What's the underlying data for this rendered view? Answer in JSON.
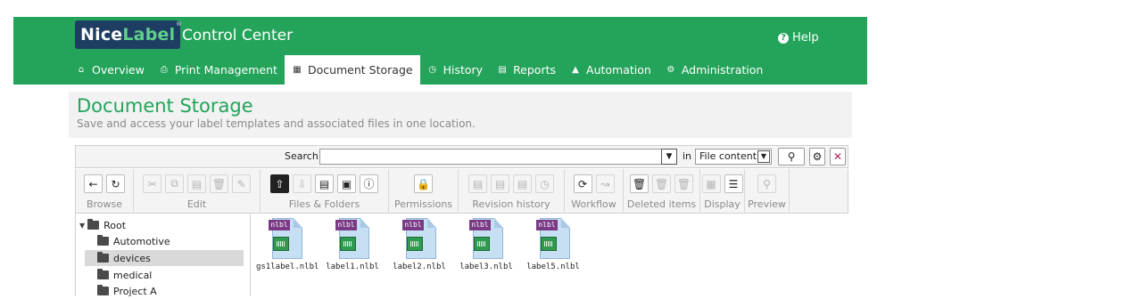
{
  "header": {
    "logo_primary": "Nice",
    "logo_secondary": "Label",
    "logo_mark": "®",
    "app_title": "Control Center",
    "help_label": "Help",
    "brand_color": "#24a35a"
  },
  "nav": {
    "items": [
      {
        "label": "Overview",
        "icon": "home-icon",
        "active": false
      },
      {
        "label": "Print Management",
        "icon": "printer-icon",
        "active": false
      },
      {
        "label": "Document Storage",
        "icon": "storage-icon",
        "active": true
      },
      {
        "label": "History",
        "icon": "clock-icon",
        "active": false
      },
      {
        "label": "Reports",
        "icon": "chart-icon",
        "active": false
      },
      {
        "label": "Automation",
        "icon": "automation-icon",
        "active": false
      },
      {
        "label": "Administration",
        "icon": "gears-icon",
        "active": false
      }
    ]
  },
  "page": {
    "title": "Document Storage",
    "subtitle": "Save and access your label templates and associated files in one location."
  },
  "search": {
    "label": "Search:",
    "value": "",
    "in_label": "in",
    "scope_selected": "File content"
  },
  "toolbar": {
    "groups": [
      {
        "label": "Browse"
      },
      {
        "label": "Edit"
      },
      {
        "label": "Files & Folders"
      },
      {
        "label": "Permissions"
      },
      {
        "label": "Revision history"
      },
      {
        "label": "Workflow"
      },
      {
        "label": "Deleted items"
      },
      {
        "label": "Display"
      },
      {
        "label": "Preview"
      }
    ]
  },
  "tree": {
    "root": "Root",
    "folders": [
      "Automotive",
      "devices",
      "medical",
      "Project A"
    ],
    "selected": "devices"
  },
  "files": {
    "type_tag": "nlbl",
    "items": [
      "gs1label.nlbl",
      "label1.nlbl",
      "label2.nlbl",
      "label3.nlbl",
      "label5.nlbl"
    ]
  }
}
